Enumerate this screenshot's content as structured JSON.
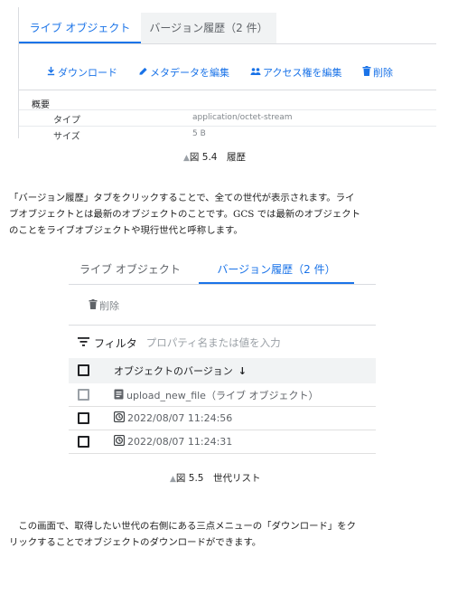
{
  "figure_5_4": {
    "tabs": [
      "ライブ オブジェクト",
      "バージョン履歴（2 件）"
    ],
    "actions": [
      "ダウンロード",
      "メタデータを編集",
      "アクセス権を編集",
      "削除"
    ],
    "summary_label": "概要",
    "rows": [
      {
        "key": "タイプ",
        "value": "application/octet-stream"
      },
      {
        "key": "サイズ",
        "value": "5 B"
      }
    ],
    "caption_mark": "▲",
    "caption": "図 5.4　履歴"
  },
  "paragraph_1": [
    "「バージョン履歴」タブをクリックすることで、全ての世代が表示されます。ライ",
    "ブオブジェクトとは最新のオブジェクトのことです。GCS では最新のオブジェクト",
    "のことをライブオブジェクトや現行世代と呼称します。"
  ],
  "figure_5_5": {
    "tabs": [
      "ライブ オブジェクト",
      "バージョン履歴（2 件）"
    ],
    "delete_label": "削除",
    "filter_label": "フィルタ",
    "filter_placeholder": "プロパティ名または値を入力",
    "column_header": "オブジェクトのバージョン",
    "sort_arrow": "↓",
    "rows": [
      {
        "icon": "file-icon",
        "label": "upload_new_file（ライブ オブジェクト）"
      },
      {
        "icon": "history-icon",
        "label": "2022/08/07 11:24:56"
      },
      {
        "icon": "history-icon",
        "label": "2022/08/07 11:24:31"
      }
    ],
    "caption_mark": "▲",
    "caption": "図 5.5　世代リスト"
  },
  "paragraph_2": [
    "　この画面で、取得したい世代の右側にある三点メニューの「ダウンロード」をク",
    "リックすることでオブジェクトのダウンロードができます。"
  ],
  "colors": {
    "accent": "#1a73e8",
    "tab_bg": "#f1f3f4",
    "muted": "#5f6368"
  }
}
